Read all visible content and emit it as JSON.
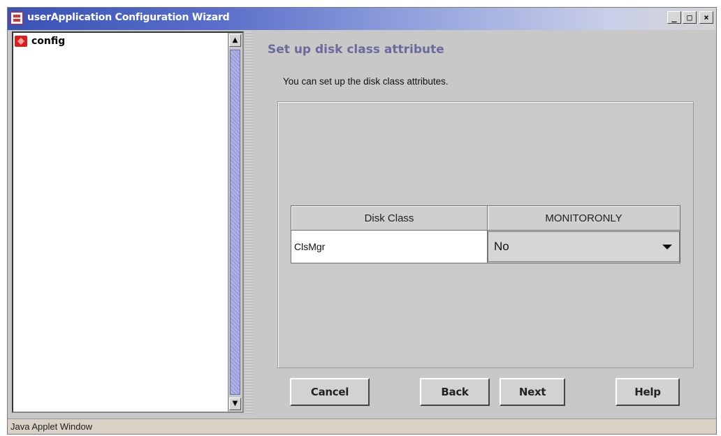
{
  "window": {
    "title": "userApplication Configuration Wizard",
    "controls": {
      "minimize": "_",
      "maximize": "□",
      "close": "×"
    }
  },
  "tree": {
    "items": [
      {
        "label": "config",
        "icon": "config-icon"
      }
    ]
  },
  "content": {
    "heading": "Set up disk class attribute",
    "description": "You can set up the disk class attributes.",
    "table": {
      "headers": [
        "Disk Class",
        "MONITORONLY"
      ],
      "rows": [
        {
          "disk_class": "ClsMgr",
          "monitoronly": "No"
        }
      ]
    }
  },
  "buttons": {
    "cancel": "Cancel",
    "back": "Back",
    "next": "Next",
    "help": "Help"
  },
  "status": "Java Applet Window"
}
